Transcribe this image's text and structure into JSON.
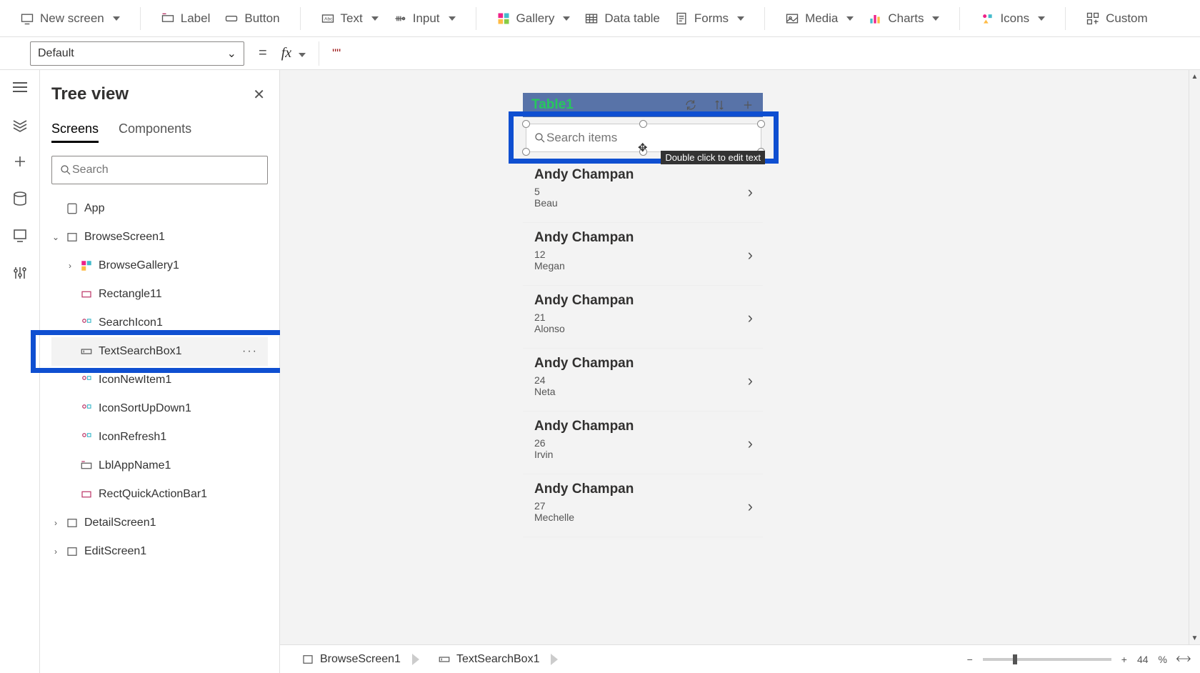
{
  "ribbon": {
    "newScreen": "New screen",
    "label": "Label",
    "button": "Button",
    "text": "Text",
    "input": "Input",
    "gallery": "Gallery",
    "dataTable": "Data table",
    "forms": "Forms",
    "media": "Media",
    "charts": "Charts",
    "icons": "Icons",
    "custom": "Custom"
  },
  "formula": {
    "property": "Default",
    "value": "\"\""
  },
  "treePanel": {
    "title": "Tree view",
    "tab_screens": "Screens",
    "tab_components": "Components",
    "search_placeholder": "Search",
    "app": "App",
    "nodes": {
      "browseScreen": "BrowseScreen1",
      "browseGallery": "BrowseGallery1",
      "rectangle11": "Rectangle11",
      "searchIcon1": "SearchIcon1",
      "textSearchBox1": "TextSearchBox1",
      "iconNewItem1": "IconNewItem1",
      "iconSortUpDown1": "IconSortUpDown1",
      "iconRefresh1": "IconRefresh1",
      "lblAppName1": "LblAppName1",
      "rectQuickActionBar1": "RectQuickActionBar1",
      "detailScreen1": "DetailScreen1",
      "editScreen1": "EditScreen1"
    }
  },
  "canvas": {
    "appTitle": "Table1",
    "searchPlaceholder": "Search items",
    "tooltip": "Double click to edit text",
    "rows": [
      {
        "name": "Andy Champan",
        "val": "5",
        "sub": "Beau"
      },
      {
        "name": "Andy Champan",
        "val": "12",
        "sub": "Megan"
      },
      {
        "name": "Andy Champan",
        "val": "21",
        "sub": "Alonso"
      },
      {
        "name": "Andy Champan",
        "val": "24",
        "sub": "Neta"
      },
      {
        "name": "Andy Champan",
        "val": "26",
        "sub": "Irvin"
      },
      {
        "name": "Andy Champan",
        "val": "27",
        "sub": "Mechelle"
      }
    ]
  },
  "footer": {
    "crumb1": "BrowseScreen1",
    "crumb2": "TextSearchBox1",
    "zoomPct": "44",
    "zoomSym": "%"
  }
}
